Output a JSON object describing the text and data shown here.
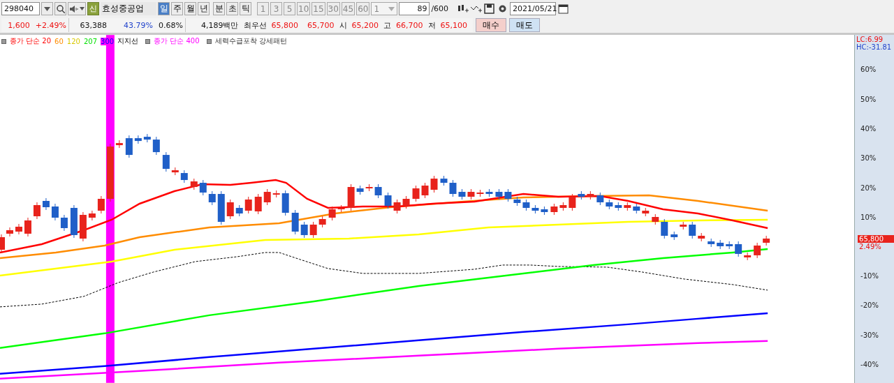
{
  "toolbar": {
    "code": "298040",
    "badge": "신",
    "stock_name": "효성중공업",
    "periods": [
      {
        "label": "일",
        "selected": true
      },
      {
        "label": "주",
        "selected": false
      },
      {
        "label": "월",
        "selected": false
      },
      {
        "label": "년",
        "selected": false
      },
      {
        "label": "분",
        "selected": false
      },
      {
        "label": "초",
        "selected": false
      },
      {
        "label": "틱",
        "selected": false
      }
    ],
    "intervals": [
      "1",
      "3",
      "5",
      "10",
      "15",
      "30",
      "45",
      "60"
    ],
    "unit": "1",
    "count": "89",
    "count_max": "/600",
    "date": "2021/05/21"
  },
  "quote": {
    "change": "1,600",
    "change_pct": "+2.49%",
    "volume": "63,388",
    "volume_ratio": "43.79%",
    "turnover": "0.68%",
    "amount": "4,189백만",
    "best_label": "최우선",
    "ask": "65,800",
    "bid": "65,700",
    "ohlc": [
      {
        "label": "시",
        "value": "65,200"
      },
      {
        "label": "고",
        "value": "66,700"
      },
      {
        "label": "저",
        "value": "65,100"
      }
    ],
    "buy": "매수",
    "sell": "매도"
  },
  "legend": [
    {
      "parts": [
        {
          "text": "종가 단순 20",
          "highlighted": false
        },
        {
          "text": "60",
          "highlighted": false
        },
        {
          "text": "120",
          "highlighted": false
        },
        {
          "text": "207",
          "highlighted": false
        },
        {
          "text": "300",
          "highlighted": true
        },
        {
          "text": "지지선",
          "highlighted": false
        }
      ]
    },
    {
      "parts": [
        {
          "text": "종가 단순 400",
          "highlighted": false
        }
      ]
    },
    {
      "parts": [
        {
          "text": "세력수급포착 강세패턴",
          "highlighted": false
        }
      ]
    }
  ],
  "axis": {
    "lc": "LC:6.99",
    "hc": "HC:-31.81",
    "ticks": [
      "60%",
      "50%",
      "40%",
      "30%",
      "20%",
      "10%",
      "-10%",
      "-20%",
      "-30%",
      "-40%"
    ],
    "price": "65,800",
    "price_pct": "2.49%"
  }
}
